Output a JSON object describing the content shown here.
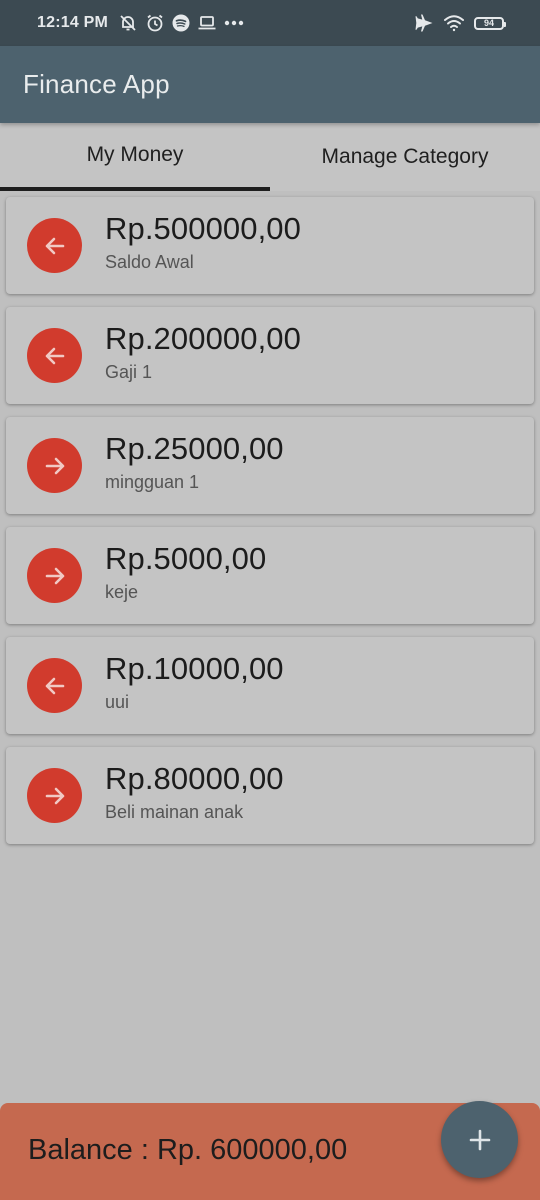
{
  "status_bar": {
    "time": "12:14 PM",
    "left_icons": [
      "notifications-off-icon",
      "alarm-icon",
      "spotify-icon",
      "laptop-icon",
      "more-dots-icon"
    ],
    "right_icons": [
      "airplane-mode-icon",
      "wifi-icon",
      "battery-icon"
    ],
    "battery_level": "94"
  },
  "app_bar": {
    "title": "Finance App"
  },
  "tabs": [
    {
      "label": "My Money",
      "active": true
    },
    {
      "label": "Manage Category",
      "active": false
    }
  ],
  "transactions": [
    {
      "amount": "Rp.500000,00",
      "description": "Saldo Awal",
      "direction": "income",
      "icon": "arrow-left-icon"
    },
    {
      "amount": "Rp.200000,00",
      "description": "Gaji 1",
      "direction": "income",
      "icon": "arrow-left-icon"
    },
    {
      "amount": "Rp.25000,00",
      "description": "mingguan 1",
      "direction": "expense",
      "icon": "arrow-right-icon"
    },
    {
      "amount": "Rp.5000,00",
      "description": "keje",
      "direction": "expense",
      "icon": "arrow-right-icon"
    },
    {
      "amount": "Rp.10000,00",
      "description": "uui",
      "direction": "income",
      "icon": "arrow-left-icon"
    },
    {
      "amount": "Rp.80000,00",
      "description": "Beli mainan anak",
      "direction": "expense",
      "icon": "arrow-right-icon"
    }
  ],
  "balance": {
    "text": "Balance : Rp. 600000,00"
  },
  "fab": {
    "icon": "plus-icon"
  },
  "colors": {
    "status_bar": "#3c4a52",
    "app_bar": "#4d626e",
    "background": "#bfbfbf",
    "card": "#c4c4c4",
    "arrow_circle": "#d13b2d",
    "balance_bar": "#c5694f",
    "fab": "#4d626e"
  }
}
